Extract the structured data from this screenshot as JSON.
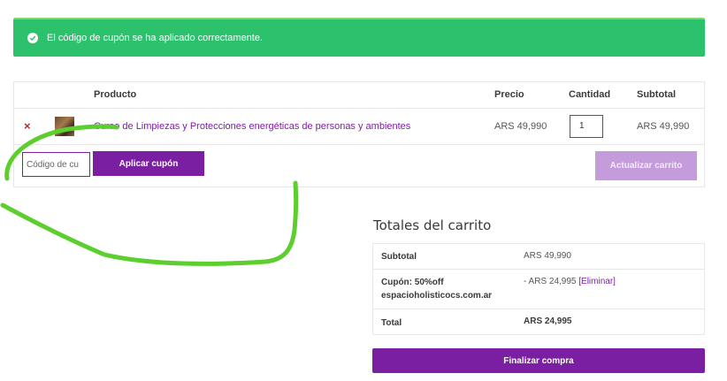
{
  "notice": {
    "message": "El código de cupón se ha aplicado correctamente.",
    "icon": "check-circle-icon",
    "color": "#2cc26d"
  },
  "cart": {
    "headers": {
      "product": "Producto",
      "price": "Precio",
      "quantity": "Cantidad",
      "subtotal": "Subtotal"
    },
    "items": [
      {
        "remove_symbol": "×",
        "name": "Curso de Limpiezas y Protecciones energéticas de personas y ambientes",
        "price": "ARS 49,990",
        "quantity": "1",
        "subtotal": "ARS 49,990"
      }
    ],
    "coupon_placeholder": "Código de cupón",
    "coupon_visible_text": "Código de cu",
    "apply_coupon_label": "Aplicar cupón",
    "update_cart_label": "Actualizar carrito"
  },
  "totals": {
    "title": "Totales del carrito",
    "subtotal_label": "Subtotal",
    "subtotal_value": "ARS 49,990",
    "coupon_label_1": "Cupón: 50%off",
    "coupon_label_2": "espacioholisticocs.com.ar",
    "coupon_value": "- ARS 24,995",
    "remove_coupon_label": "[Eliminar]",
    "total_label": "Total",
    "total_value": "ARS 24,995"
  },
  "checkout_label": "Finalizar compra",
  "colors": {
    "accent": "#7b1fa2",
    "accent_disabled": "#c59cdb",
    "success": "#2cc26d",
    "annotation": "#5ccf2e"
  }
}
